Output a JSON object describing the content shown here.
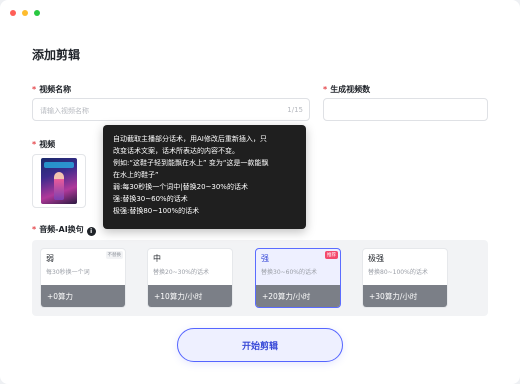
{
  "page": {
    "title": "添加剪辑"
  },
  "video_name": {
    "label": "视频名称",
    "placeholder": "请输入视频名称",
    "counter": "1/15"
  },
  "generate_count": {
    "label": "生成视频数",
    "value": ""
  },
  "video": {
    "label": "视频"
  },
  "audio": {
    "label": "音频-AI换句",
    "info": "i"
  },
  "tooltip": {
    "lines": [
      "自动截取主播部分话术，用AI修改后重新插入，只",
      "改变话术文案，话术所表达的内容不变。",
      "例如:“这鞋子轻到能飘在水上” 变为“这是一款能飘",
      "在水上的鞋子”",
      "弱:每30秒换一个词中|替换20~30%的话术",
      "强:替换30~60%的话术",
      "极强:替换80~100%的话术"
    ]
  },
  "options": [
    {
      "name": "弱",
      "desc": "每30秒换一个词",
      "cost": "+0算力",
      "badge": "不替换"
    },
    {
      "name": "中",
      "desc": "替换20~30%的话术",
      "cost": "+10算力/小时",
      "badge": ""
    },
    {
      "name": "强",
      "desc": "替换30~60%的话术",
      "cost": "+20算力/小时",
      "badge": "推荐"
    },
    {
      "name": "极强",
      "desc": "替换80~100%的话术",
      "cost": "+30算力/小时",
      "badge": ""
    }
  ],
  "start_button": {
    "label": "开始剪辑"
  },
  "colors": {
    "accent": "#5565ff",
    "required": "#e5484d",
    "tooltip_bg": "#1f1f1f",
    "recommend_badge": "#f44a6d"
  },
  "selected_option": "强"
}
